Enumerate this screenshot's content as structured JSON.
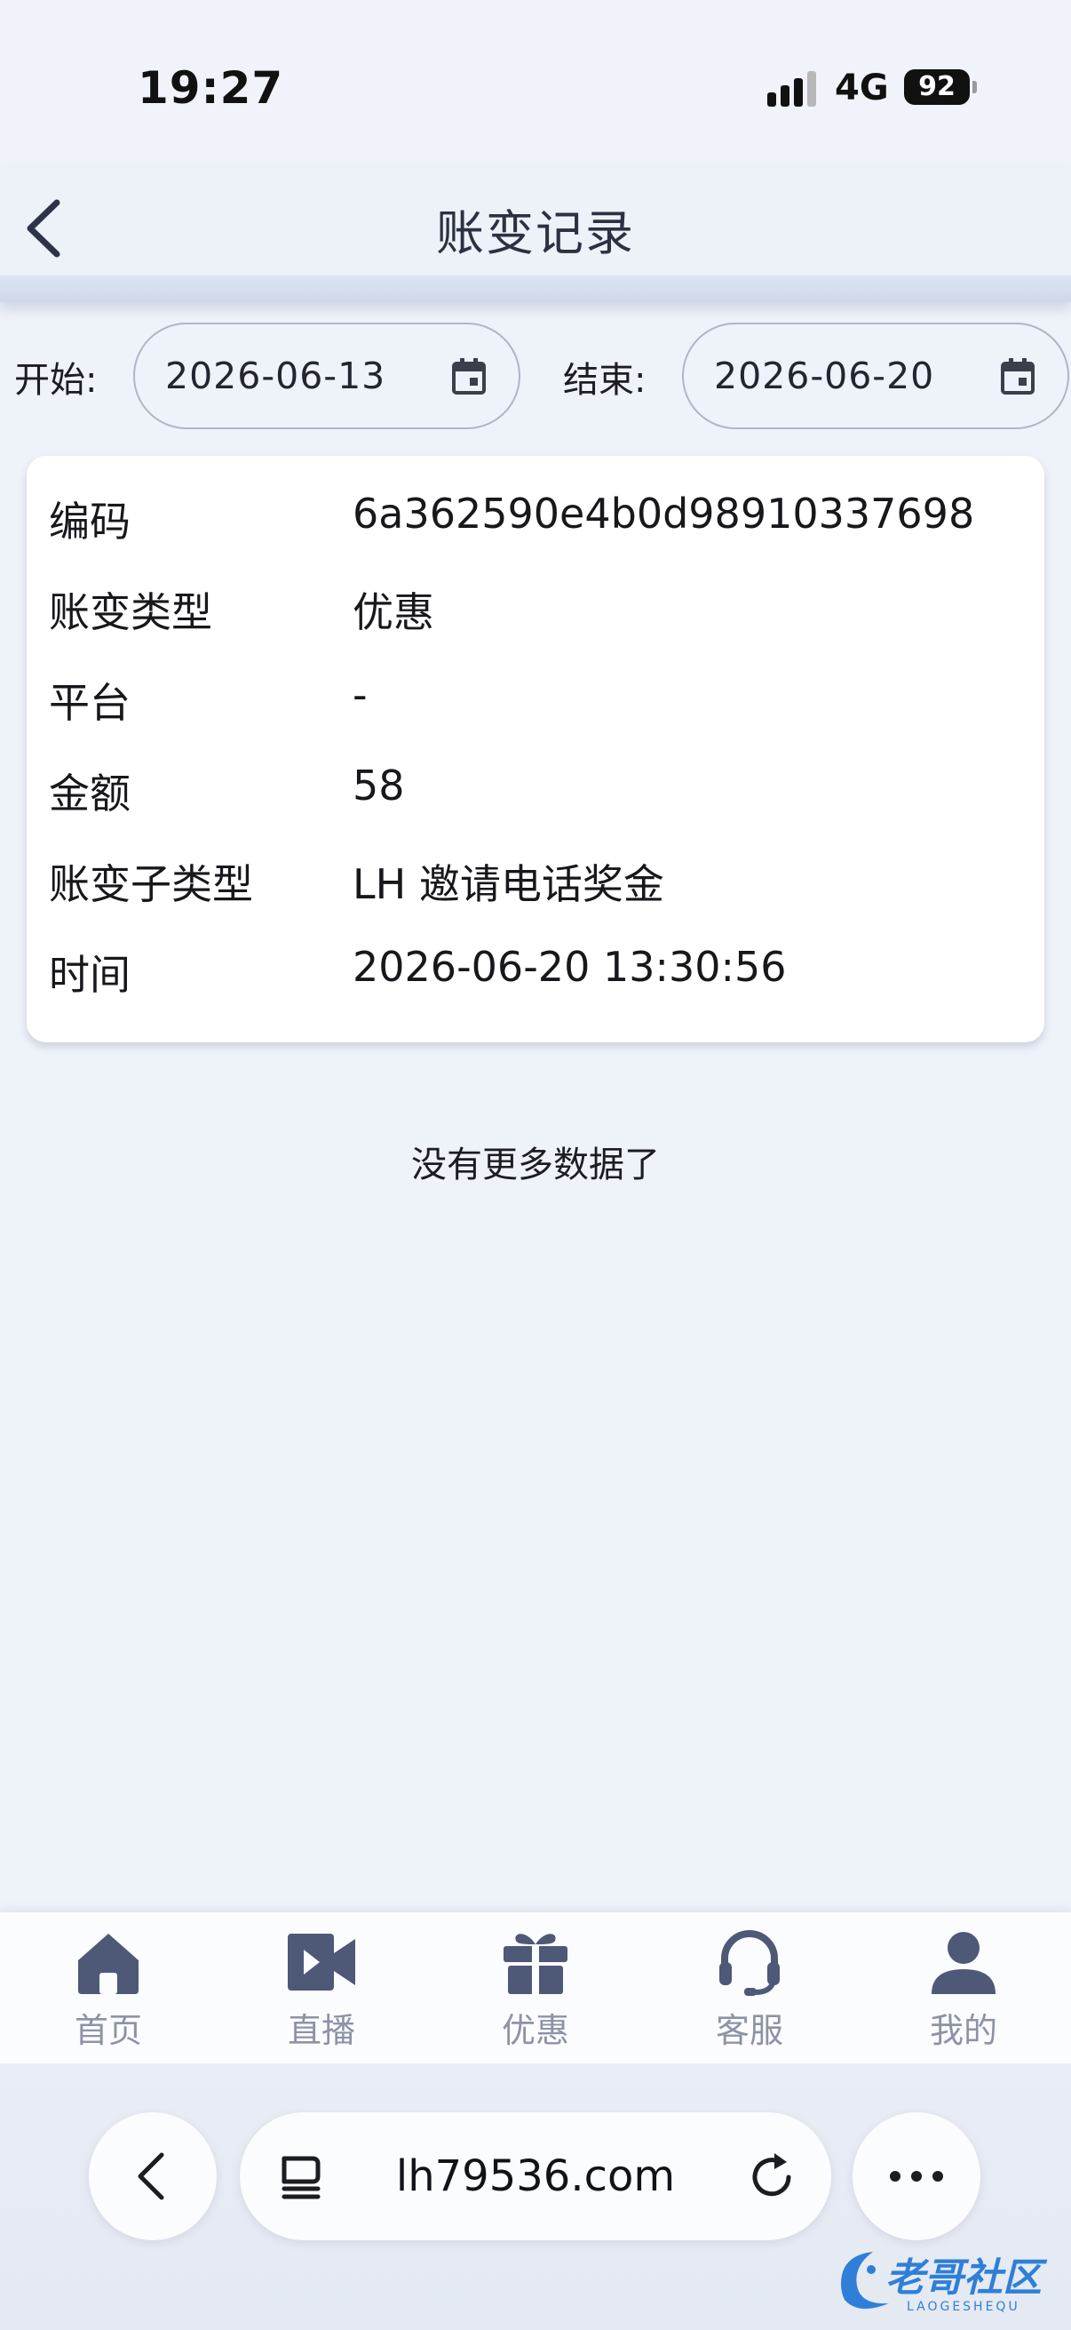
{
  "status_bar": {
    "time": "19:27",
    "network": "4G",
    "battery": "92"
  },
  "header": {
    "title": "账变记录"
  },
  "filters": {
    "start_label": "开始:",
    "start_date": "2026-06-13",
    "end_label": "结束:",
    "end_date": "2026-06-20"
  },
  "record": {
    "rows": [
      {
        "key": "编码",
        "value": "6a362590e4b0d98910337698"
      },
      {
        "key": "账变类型",
        "value": "优惠"
      },
      {
        "key": "平台",
        "value": "-"
      },
      {
        "key": "金额",
        "value": "58"
      },
      {
        "key": "账变子类型",
        "value": "LH 邀请电话奖金"
      },
      {
        "key": "时间",
        "value": "2026-06-20 13:30:56"
      }
    ]
  },
  "no_more_text": "没有更多数据了",
  "tabs": [
    {
      "label": "首页",
      "icon": "home-icon"
    },
    {
      "label": "直播",
      "icon": "video-icon"
    },
    {
      "label": "优惠",
      "icon": "gift-icon"
    },
    {
      "label": "客服",
      "icon": "headset-icon"
    },
    {
      "label": "我的",
      "icon": "user-icon"
    }
  ],
  "browser": {
    "url": "lh79536.com"
  },
  "watermark": {
    "text": "老哥社区",
    "subtext": "LAOGESHEQU"
  },
  "colors": {
    "tab_icon": "#4e5877",
    "tab_label": "#8c93a5",
    "page_bg": "#eef2f9",
    "card_bg": "#ffffff"
  }
}
